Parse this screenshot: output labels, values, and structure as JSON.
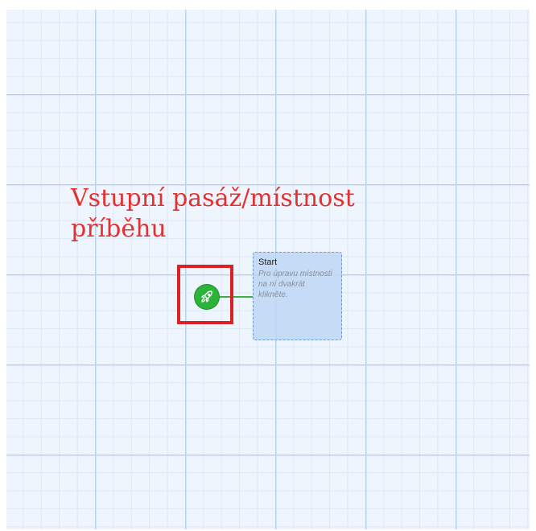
{
  "annotation": {
    "text": "Vstupní pasáž/místnost příběhu",
    "color": "#e53030"
  },
  "story_map": {
    "start_node": {
      "icon": "rocket-icon",
      "color": "#2bb33a",
      "highlight_color": "#dd1f26"
    },
    "room": {
      "title": "Start",
      "description": "Pro úpravu místnosti na ní dvakrát klikněte."
    }
  }
}
